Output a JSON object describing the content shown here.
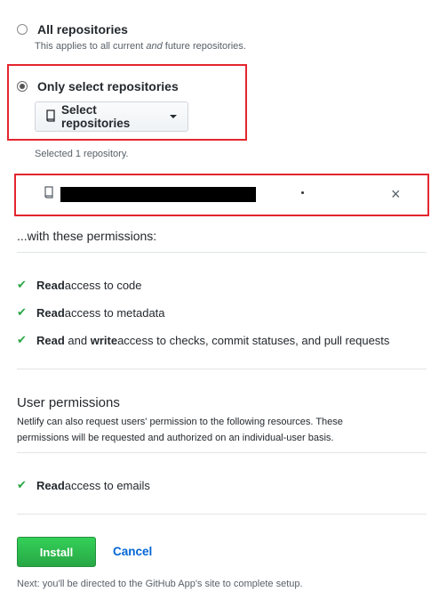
{
  "options": {
    "all": {
      "label": "All repositories",
      "note_prefix": "This applies to all current ",
      "note_em": "and",
      "note_suffix": " future repositories."
    },
    "select": {
      "label": "Only select repositories",
      "button_label": "Select repositories"
    }
  },
  "selected_count_text": "Selected 1 repository.",
  "selected_repo": {
    "name_redacted": true,
    "remove_symbol": "×"
  },
  "permissions_heading": "...with these permissions:",
  "repo_permissions": [
    {
      "bold": "Read",
      "rest": " access to code"
    },
    {
      "bold": "Read",
      "rest": " access to metadata"
    },
    {
      "bold": "Read",
      "mid": " and ",
      "bold2": "write",
      "rest": " access to checks, commit statuses, and pull requests"
    }
  ],
  "user_permissions": {
    "title": "User permissions",
    "description": "Netlify can also request users' permission to the following resources. These permissions will be requested and authorized on an individual-user basis.",
    "items": [
      {
        "bold": "Read",
        "rest": " access to emails"
      }
    ]
  },
  "actions": {
    "install_label": "Install",
    "cancel_label": "Cancel"
  },
  "footer_note": "Next: you'll be directed to the GitHub App's site to complete setup.",
  "colors": {
    "highlight": "#e3262e",
    "install_green": "#2ea44f",
    "link_blue": "#0366d6",
    "check_green": "#28a745"
  }
}
